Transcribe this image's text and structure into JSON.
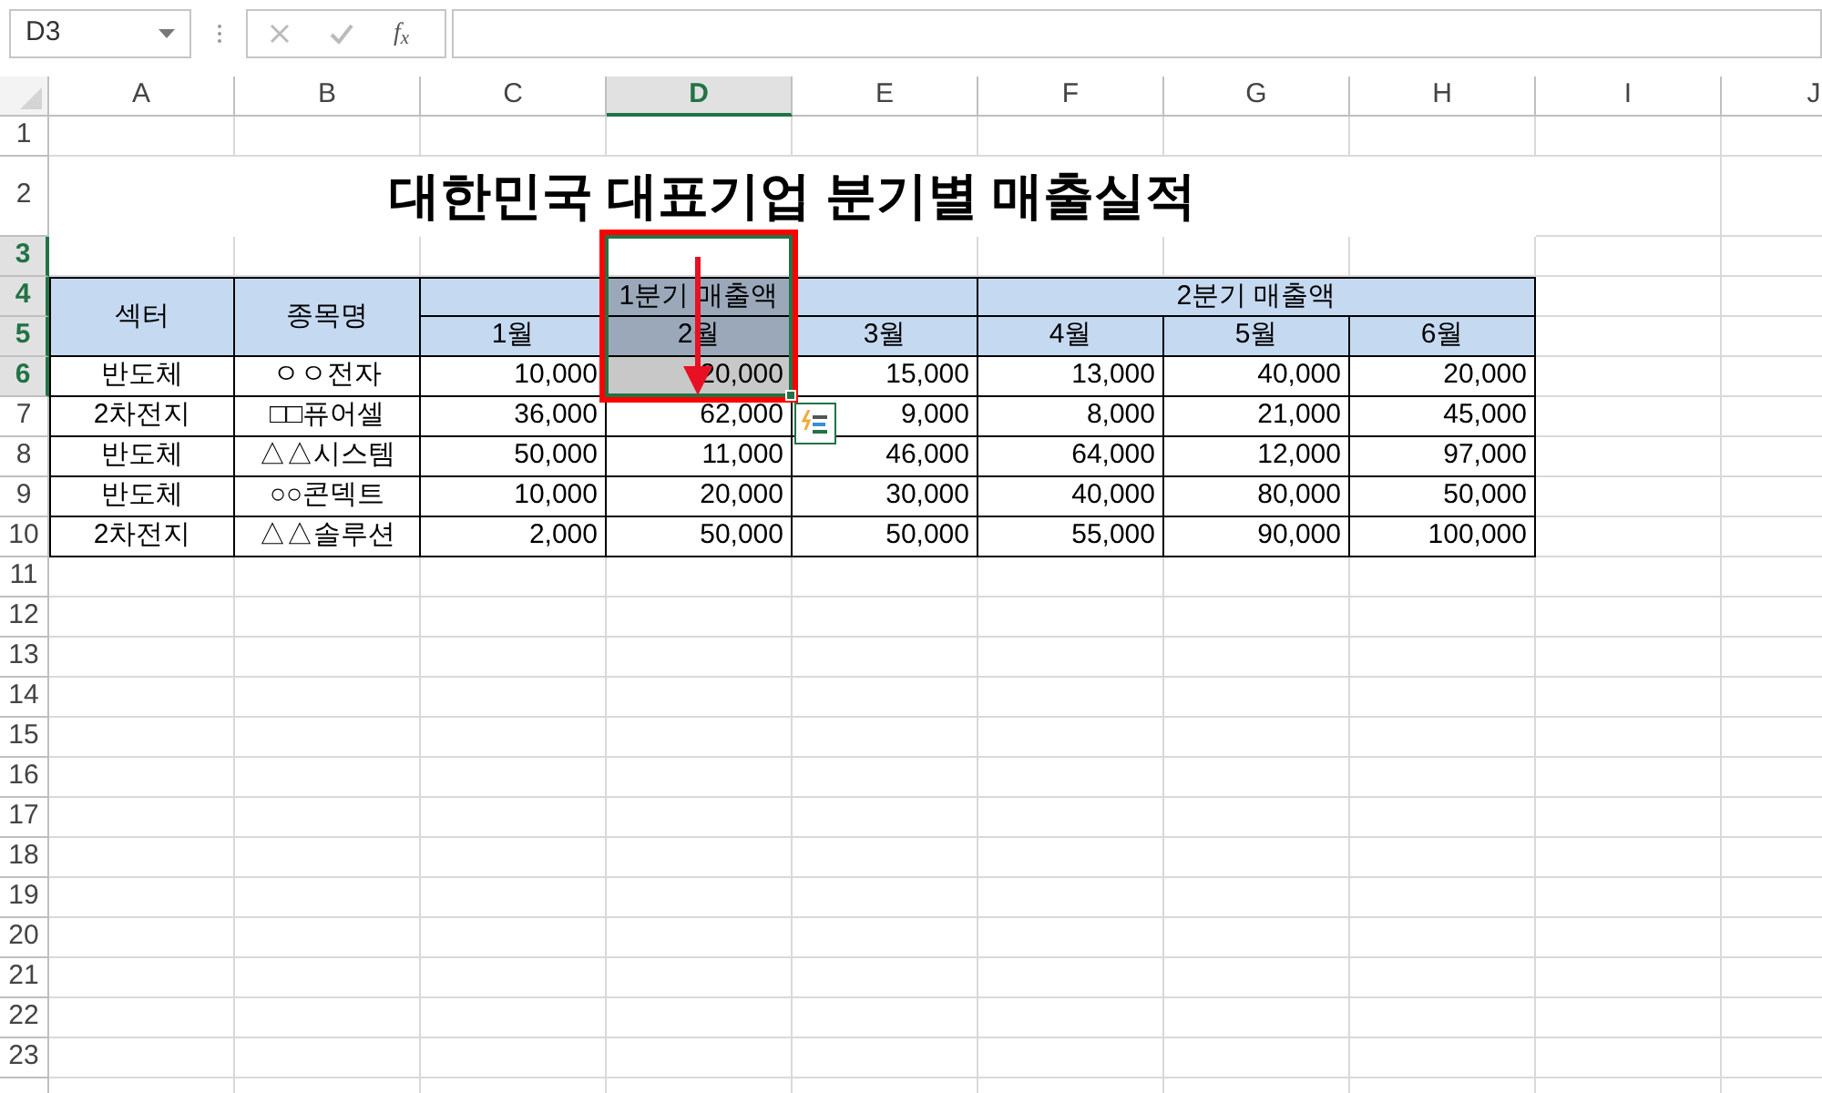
{
  "name_box": {
    "value": "D3"
  },
  "formula_bar": {
    "insert_function": "f$_{x}$"
  },
  "columns": [
    {
      "label": "A",
      "selected": false
    },
    {
      "label": "B",
      "selected": false
    },
    {
      "label": "C",
      "selected": false
    },
    {
      "label": "D",
      "selected": true
    },
    {
      "label": "E",
      "selected": false
    },
    {
      "label": "F",
      "selected": false
    },
    {
      "label": "G",
      "selected": false
    },
    {
      "label": "H",
      "selected": false
    },
    {
      "label": "I",
      "selected": false
    },
    {
      "label": "J",
      "selected": false
    }
  ],
  "rows": [
    {
      "label": "1",
      "selected": false
    },
    {
      "label": "2",
      "selected": false
    },
    {
      "label": "3",
      "selected": true
    },
    {
      "label": "4",
      "selected": true
    },
    {
      "label": "5",
      "selected": true
    },
    {
      "label": "6",
      "selected": true
    },
    {
      "label": "7",
      "selected": false
    },
    {
      "label": "8",
      "selected": false
    },
    {
      "label": "9",
      "selected": false
    },
    {
      "label": "10",
      "selected": false
    },
    {
      "label": "11",
      "selected": false
    },
    {
      "label": "12",
      "selected": false
    },
    {
      "label": "13",
      "selected": false
    },
    {
      "label": "14",
      "selected": false
    },
    {
      "label": "15",
      "selected": false
    },
    {
      "label": "16",
      "selected": false
    },
    {
      "label": "17",
      "selected": false
    },
    {
      "label": "18",
      "selected": false
    },
    {
      "label": "19",
      "selected": false
    },
    {
      "label": "20",
      "selected": false
    },
    {
      "label": "21",
      "selected": false
    },
    {
      "label": "22",
      "selected": false
    },
    {
      "label": "23",
      "selected": false
    }
  ],
  "title": "대한민국 대표기업 분기별 매출실적",
  "table": {
    "header_columns": [
      "섹터",
      "종목명"
    ],
    "groups": [
      {
        "label": "1분기 매출액",
        "months": [
          {
            "label": "1월",
            "selected": false
          },
          {
            "label": "2월",
            "selected": true
          },
          {
            "label": "3월",
            "selected": false
          }
        ]
      },
      {
        "label": "2분기 매출액",
        "months": [
          {
            "label": "4월",
            "selected": false
          },
          {
            "label": "5월",
            "selected": false
          },
          {
            "label": "6월",
            "selected": false
          }
        ]
      }
    ],
    "rows": [
      {
        "cells": [
          {
            "text": "반도체",
            "selected": false
          },
          {
            "text": "ㅇㅇ전자",
            "selected": false
          },
          {
            "text": "10,000",
            "selected": false
          },
          {
            "text": "20,000",
            "selected": true
          },
          {
            "text": "15,000",
            "selected": false
          },
          {
            "text": "13,000",
            "selected": false
          },
          {
            "text": "40,000",
            "selected": false
          },
          {
            "text": "20,000",
            "selected": false
          }
        ]
      },
      {
        "cells": [
          {
            "text": "2차전지",
            "selected": false
          },
          {
            "text": "□□퓨어셀",
            "selected": false
          },
          {
            "text": "36,000",
            "selected": false
          },
          {
            "text": "62,000",
            "selected": false
          },
          {
            "text": "9,000",
            "selected": false
          },
          {
            "text": "8,000",
            "selected": false
          },
          {
            "text": "21,000",
            "selected": false
          },
          {
            "text": "45,000",
            "selected": false
          }
        ]
      },
      {
        "cells": [
          {
            "text": "반도체",
            "selected": false
          },
          {
            "text": "△△시스템",
            "selected": false
          },
          {
            "text": "50,000",
            "selected": false
          },
          {
            "text": "11,000",
            "selected": false
          },
          {
            "text": "46,000",
            "selected": false
          },
          {
            "text": "64,000",
            "selected": false
          },
          {
            "text": "12,000",
            "selected": false
          },
          {
            "text": "97,000",
            "selected": false
          }
        ]
      },
      {
        "cells": [
          {
            "text": "반도체",
            "selected": false
          },
          {
            "text": "○○콘덱트",
            "selected": false
          },
          {
            "text": "10,000",
            "selected": false
          },
          {
            "text": "20,000",
            "selected": false
          },
          {
            "text": "30,000",
            "selected": false
          },
          {
            "text": "40,000",
            "selected": false
          },
          {
            "text": "80,000",
            "selected": false
          },
          {
            "text": "50,000",
            "selected": false
          }
        ]
      },
      {
        "cells": [
          {
            "text": "2차전지",
            "selected": false
          },
          {
            "text": "△△솔루션",
            "selected": false
          },
          {
            "text": "2,000",
            "selected": false
          },
          {
            "text": "50,000",
            "selected": false
          },
          {
            "text": "50,000",
            "selected": false
          },
          {
            "text": "55,000",
            "selected": false
          },
          {
            "text": "90,000",
            "selected": false
          },
          {
            "text": "100,000",
            "selected": false
          }
        ]
      }
    ]
  }
}
